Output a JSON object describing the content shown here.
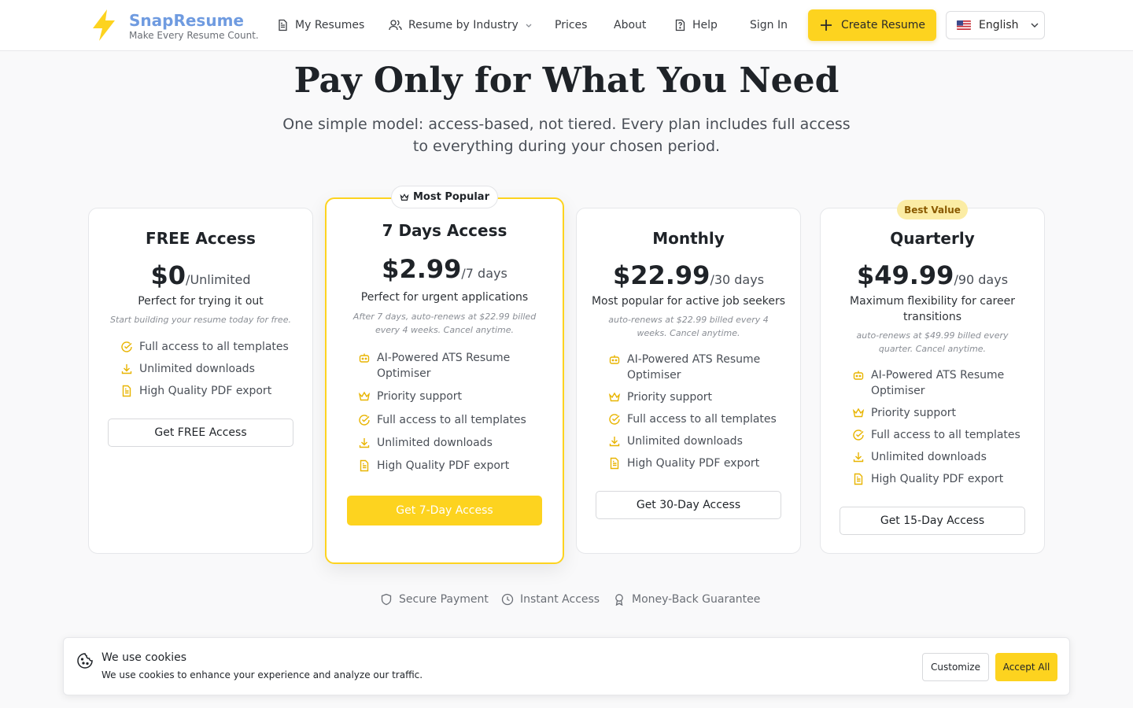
{
  "header": {
    "brand_name": "SnapResume",
    "brand_tagline": "Make Every Resume Count.",
    "nav": {
      "my_resumes": "My Resumes",
      "by_industry": "Resume by Industry",
      "prices": "Prices",
      "about": "About",
      "help": "Help",
      "sign_in": "Sign In"
    },
    "create_resume": "Create Resume",
    "language": "English"
  },
  "hero": {
    "title": "Pay Only for What You Need",
    "subtitle": "One simple model: access-based, not tiered. Every plan includes full access to everything during your chosen period."
  },
  "plans": [
    {
      "title": "FREE Access",
      "price": "$0",
      "period": "/Unlimited",
      "description": "Perfect for trying it out",
      "note": "Start building your resume today for free.",
      "features": [
        {
          "icon": "check-circle-icon",
          "text": "Full access to all templates"
        },
        {
          "icon": "download-icon",
          "text": "Unlimited downloads"
        },
        {
          "icon": "file-icon",
          "text": "High Quality PDF export"
        }
      ],
      "cta": "Get FREE Access"
    },
    {
      "badge": "Most Popular",
      "title": "7 Days Access",
      "price": "$2.99",
      "period": "/7 days",
      "description": "Perfect for urgent applications",
      "note": "After 7 days, auto-renews at $22.99 billed every 4 weeks. Cancel anytime.",
      "features": [
        {
          "icon": "robot-icon",
          "text": "AI-Powered ATS Resume Optimiser"
        },
        {
          "icon": "crown-icon",
          "text": "Priority support"
        },
        {
          "icon": "check-circle-icon",
          "text": "Full access to all templates"
        },
        {
          "icon": "download-icon",
          "text": "Unlimited downloads"
        },
        {
          "icon": "file-icon",
          "text": "High Quality PDF export"
        }
      ],
      "cta": "Get 7-Day Access"
    },
    {
      "title": "Monthly",
      "price": "$22.99",
      "period": "/30 days",
      "description": "Most popular for active job seekers",
      "note": "auto-renews at $22.99 billed every 4 weeks. Cancel anytime.",
      "features": [
        {
          "icon": "robot-icon",
          "text": "AI-Powered ATS Resume Optimiser"
        },
        {
          "icon": "crown-icon",
          "text": "Priority support"
        },
        {
          "icon": "check-circle-icon",
          "text": "Full access to all templates"
        },
        {
          "icon": "download-icon",
          "text": "Unlimited downloads"
        },
        {
          "icon": "file-icon",
          "text": "High Quality PDF export"
        }
      ],
      "cta": "Get 30-Day Access"
    },
    {
      "badge": "Best Value",
      "title": "Quarterly",
      "price": "$49.99",
      "period": "/90 days",
      "description": "Maximum flexibility for career transitions",
      "note": "auto-renews at $49.99 billed every quarter. Cancel anytime.",
      "features": [
        {
          "icon": "robot-icon",
          "text": "AI-Powered ATS Resume Optimiser"
        },
        {
          "icon": "crown-icon",
          "text": "Priority support"
        },
        {
          "icon": "check-circle-icon",
          "text": "Full access to all templates"
        },
        {
          "icon": "download-icon",
          "text": "Unlimited downloads"
        },
        {
          "icon": "file-icon",
          "text": "High Quality PDF export"
        }
      ],
      "cta": "Get 15-Day Access"
    }
  ],
  "trust": {
    "secure": "Secure Payment",
    "instant": "Instant Access",
    "guarantee": "Money-Back Guarantee"
  },
  "cookie": {
    "title": "We use cookies",
    "text": "We use cookies to enhance your experience and analyze our traffic.",
    "customize": "Customize",
    "accept": "Accept All"
  },
  "colors": {
    "accent": "#fdd31f",
    "brand_text": "#6f9be0",
    "icon": "#e8b400"
  }
}
